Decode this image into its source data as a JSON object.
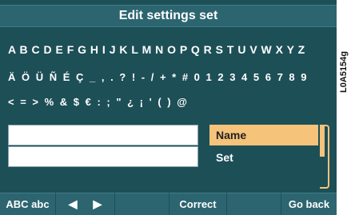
{
  "title": "Edit settings set",
  "char_rows": [
    "A B C D E F G H I J K L M N O P Q R S T U V W X Y Z",
    "Ä Ö Ü Ñ É Ç _ , . ? ! - / + * # 0 1 2 3 4 5 6 7 8 9",
    "< = > % & $ € : ; \" ¿ ¡ ' ( ) @"
  ],
  "fields": [
    {
      "value": ""
    },
    {
      "value": ""
    }
  ],
  "menu": {
    "items": [
      {
        "label": "Name",
        "selected": true
      },
      {
        "label": "Set",
        "selected": false
      }
    ]
  },
  "softkeys": {
    "case_toggle": "ABC abc",
    "left_arrow": "◀",
    "right_arrow": "▶",
    "correct": "Correct",
    "empty": "",
    "go_back": "Go back"
  },
  "side_label": "L0A5154g",
  "colors": {
    "background": "#1d4f57",
    "bar": "#2c6570",
    "highlight": "#f5c37a"
  }
}
